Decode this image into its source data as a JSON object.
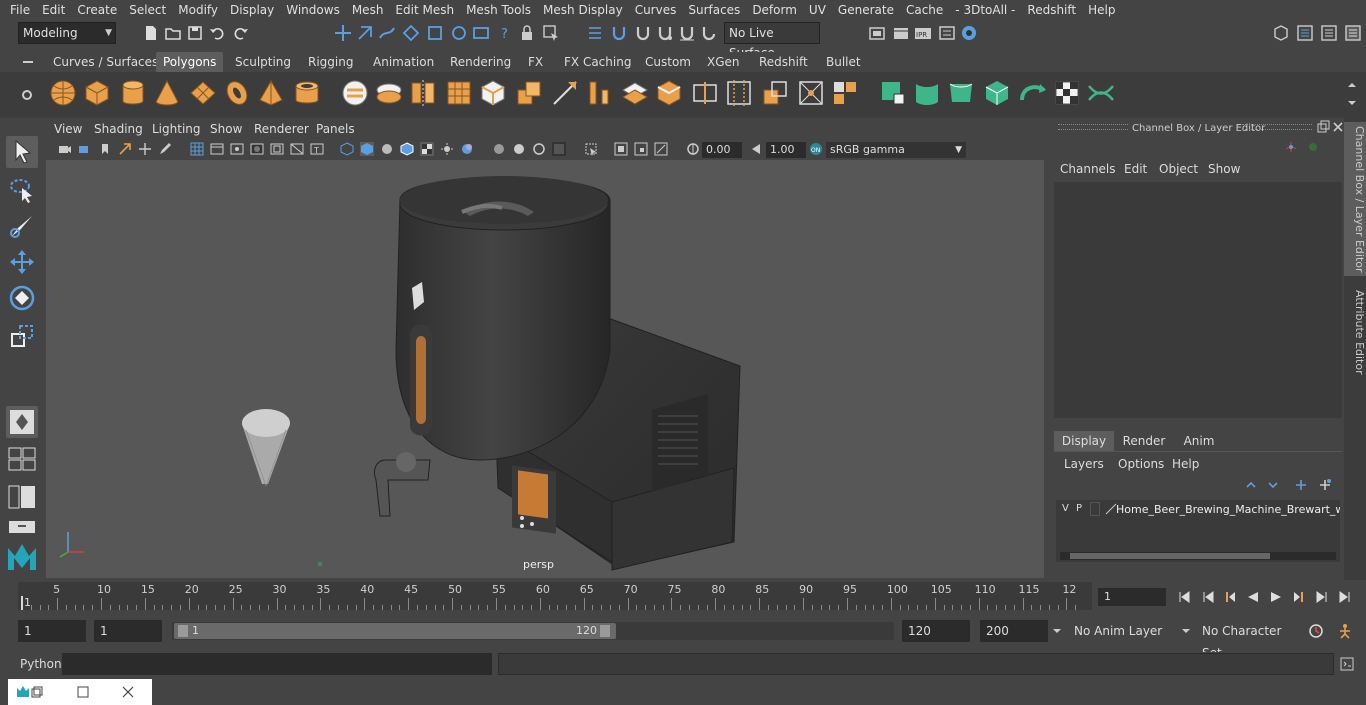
{
  "menubar": {
    "items": [
      "File",
      "Edit",
      "Create",
      "Select",
      "Modify",
      "Display",
      "Windows",
      "Mesh",
      "Edit Mesh",
      "Mesh Tools",
      "Mesh Display",
      "Curves",
      "Surfaces",
      "Deform",
      "UV",
      "Generate",
      "Cache",
      "- 3DtoAll -",
      "Redshift",
      "Help"
    ]
  },
  "statusline": {
    "mode": "Modeling",
    "live_surface": "No Live Surface"
  },
  "shelf": {
    "tabs": [
      "Curves / Surfaces",
      "Polygons",
      "Sculpting",
      "Rigging",
      "Animation",
      "Rendering",
      "FX",
      "FX Caching",
      "Custom",
      "XGen",
      "Redshift",
      "Bullet"
    ],
    "active_tab": "Polygons"
  },
  "viewport": {
    "menu": [
      "View",
      "Shading",
      "Lighting",
      "Show",
      "Renderer",
      "Panels"
    ],
    "exposure": "0.00",
    "gamma": "1.00",
    "color_space": "sRGB gamma",
    "camera_label": "persp"
  },
  "channel_box": {
    "title": "Channel Box / Layer Editor",
    "menu": [
      "Channels",
      "Edit",
      "Object",
      "Show"
    ],
    "layer_tabs": [
      "Display",
      "Render",
      "Anim"
    ],
    "active_layer_tab": "Display",
    "layer_menu": [
      "Layers",
      "Options",
      "Help"
    ],
    "layer_row": {
      "v": "V",
      "p": "P",
      "name": "Home_Beer_Brewing_Machine_Brewart_with"
    }
  },
  "side_tabs": [
    "Channel Box / Layer Editor",
    "Attribute Editor"
  ],
  "timeline": {
    "ticks": [
      "5",
      "10",
      "15",
      "20",
      "25",
      "30",
      "35",
      "40",
      "45",
      "50",
      "55",
      "60",
      "65",
      "70",
      "75",
      "80",
      "85",
      "90",
      "95",
      "100",
      "105",
      "110",
      "115",
      "12"
    ],
    "start_marker": "1",
    "current_frame": "1"
  },
  "range": {
    "start": "1",
    "playback_start": "1",
    "slider_start": "1",
    "slider_end": "120",
    "playback_end": "120",
    "end": "200",
    "anim_layer": "No Anim Layer",
    "character_set": "No Character Set"
  },
  "cmdline": {
    "label": "Python"
  },
  "colors": {
    "accent": "#5285a6",
    "shelf_orange": "#e8a04a",
    "active_tab": "#5d5d5d",
    "viewport_bg": "#575757"
  }
}
